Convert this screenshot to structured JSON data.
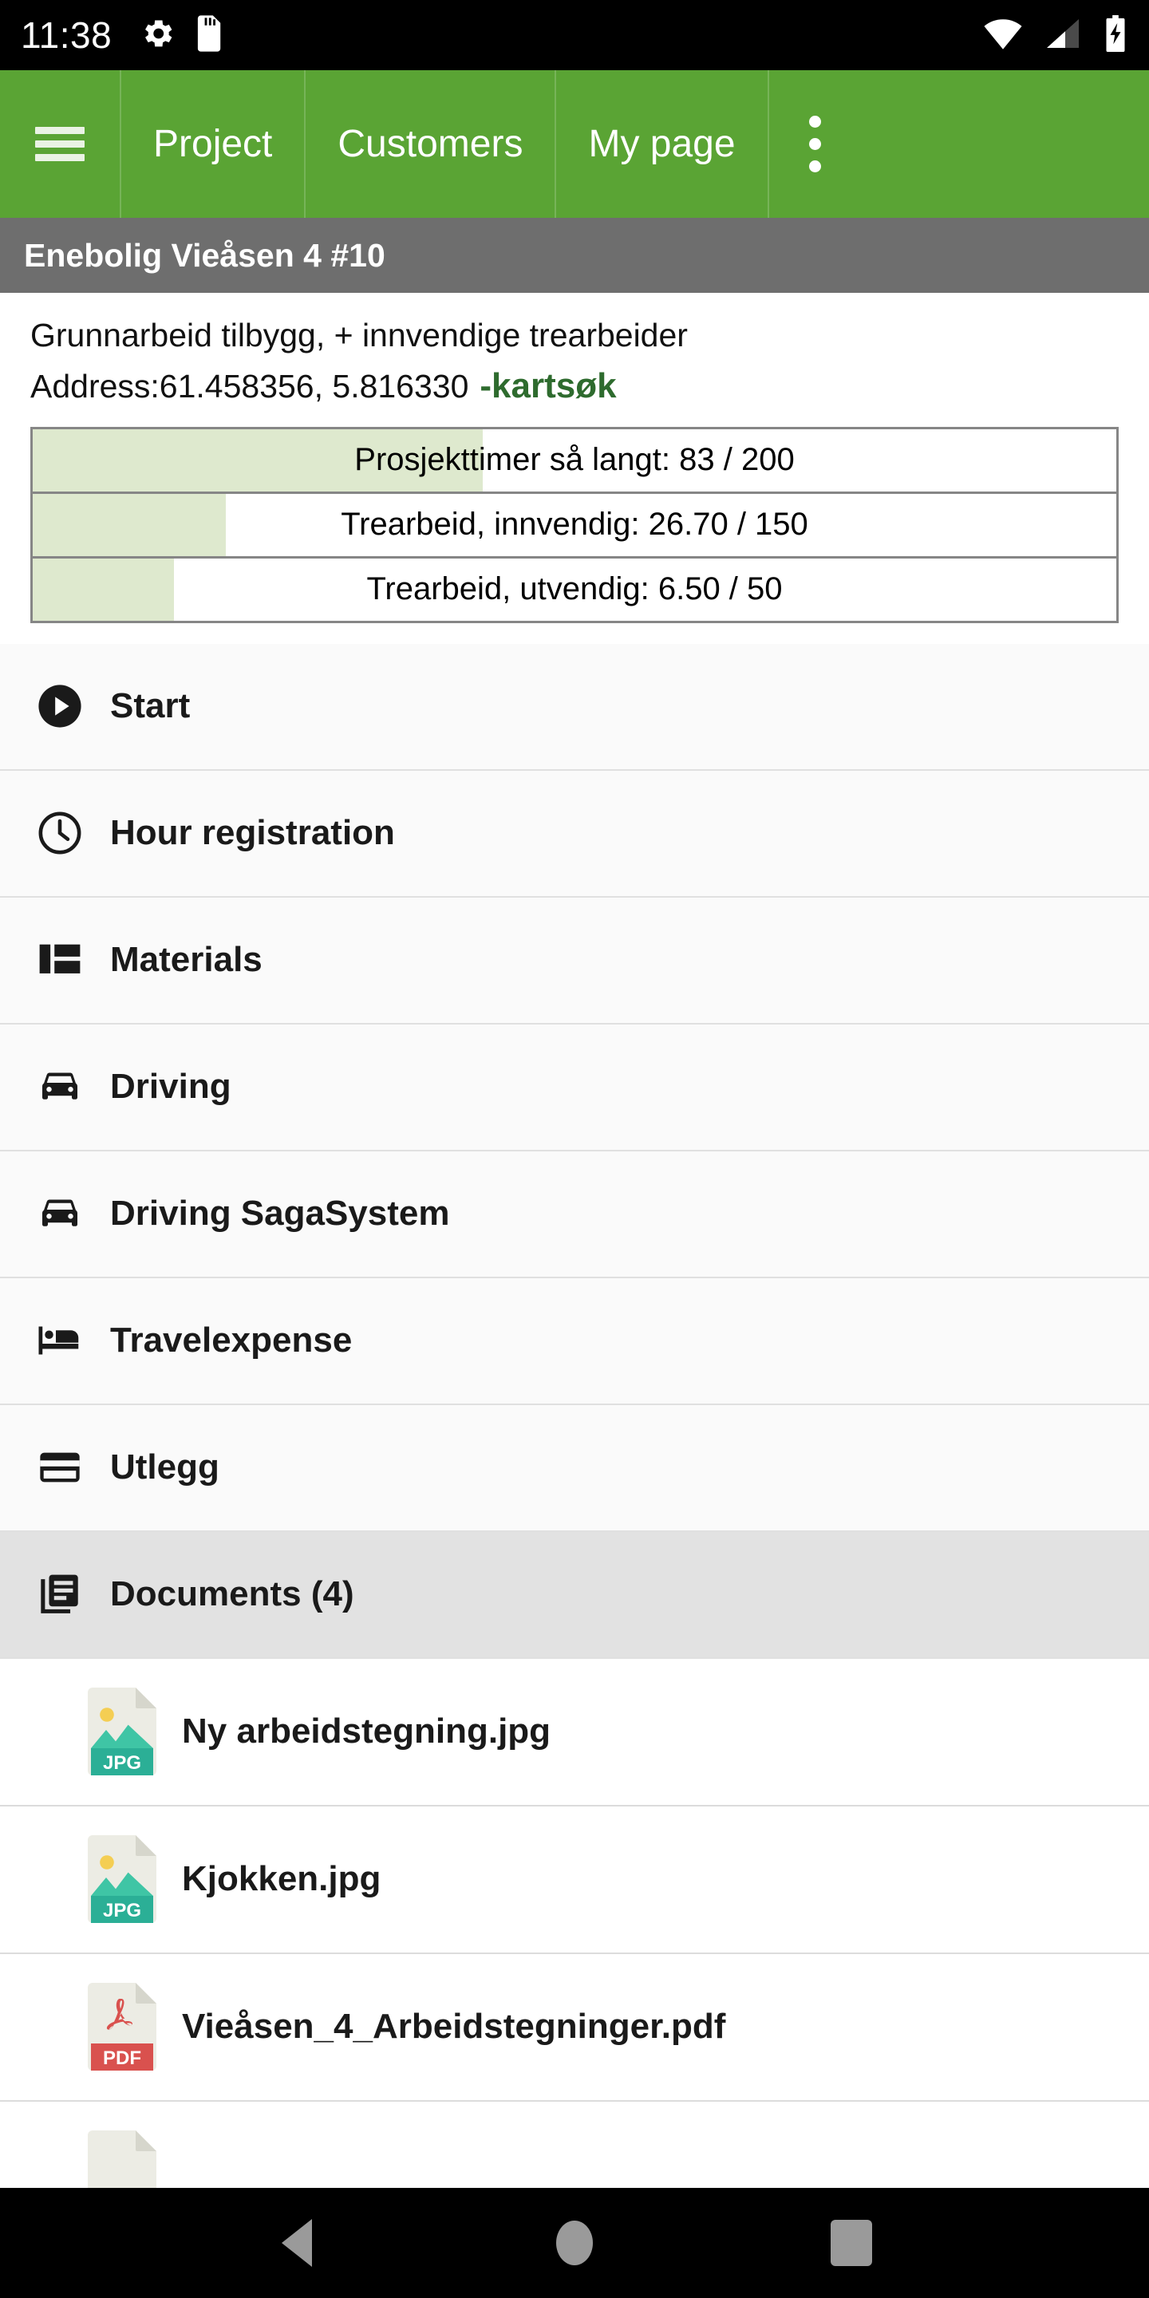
{
  "status_bar": {
    "time": "11:38",
    "left_icons": [
      "gear-icon",
      "sd-card-icon"
    ],
    "right_icons": [
      "wifi-icon",
      "cell-signal-icon",
      "battery-charging-icon"
    ]
  },
  "top_nav": {
    "menu_icon": "hamburger-menu-icon",
    "overflow_icon": "more-vertical-icon",
    "background_color": "#5AA434",
    "tabs": [
      {
        "label": "Project"
      },
      {
        "label": "Customers"
      },
      {
        "label": "My page"
      }
    ]
  },
  "project_bar": {
    "title": "Enebolig Vieåsen 4 #10",
    "background_color": "#6E6E6E"
  },
  "description": {
    "line1": "Grunnarbeid tilbygg, + innvendige trearbeider",
    "address_label": "Address:61.458356, 5.816330",
    "map_link": "-kartsøk",
    "map_link_color": "#2E6B2E"
  },
  "chart_data": {
    "type": "bar",
    "title": "Project hour progress",
    "orientation": "horizontal",
    "fill_color": "#DEE9CE",
    "border_color": "#868686",
    "categories": [
      "Prosjekttimer så langt",
      "Trearbeid, innvendig",
      "Trearbeid, utvendig"
    ],
    "values": [
      83,
      26.7,
      6.5
    ],
    "maximums": [
      200,
      150,
      50
    ],
    "percentages": [
      41.5,
      17.8,
      13.0
    ],
    "bars": [
      {
        "label": "Prosjekttimer så langt: 83 / 200",
        "value": 83,
        "max": 200,
        "percent": 41.5
      },
      {
        "label": "Trearbeid, innvendig: 26.70 / 150",
        "value": 26.7,
        "max": 150,
        "percent": 17.8
      },
      {
        "label": "Trearbeid, utvendig: 6.50 / 50",
        "value": 6.5,
        "max": 50,
        "percent": 13.0
      }
    ]
  },
  "menu": {
    "items": [
      {
        "label": "Start",
        "icon": "play-circle-icon"
      },
      {
        "label": "Hour registration",
        "icon": "clock-icon"
      },
      {
        "label": "Materials",
        "icon": "dashboard-grid-icon"
      },
      {
        "label": "Driving",
        "icon": "car-icon"
      },
      {
        "label": "Driving SagaSystem",
        "icon": "car-icon"
      },
      {
        "label": "Travelexpense",
        "icon": "hotel-bed-icon"
      },
      {
        "label": "Utlegg",
        "icon": "credit-card-icon"
      },
      {
        "label": "Documents (4)",
        "icon": "documents-icon",
        "highlighted": true
      }
    ]
  },
  "documents": {
    "count": 4,
    "files": [
      {
        "name": "Ny arbeidstegning.jpg",
        "type": "JPG",
        "icon": "jpg-file-icon"
      },
      {
        "name": "Kjokken.jpg",
        "type": "JPG",
        "icon": "jpg-file-icon"
      },
      {
        "name": "Vieåsen_4_Arbeidstegninger.pdf",
        "type": "PDF",
        "icon": "pdf-file-icon"
      }
    ]
  },
  "android_nav": {
    "back": "back-triangle-icon",
    "home": "home-circle-icon",
    "recents": "recents-square-icon"
  }
}
